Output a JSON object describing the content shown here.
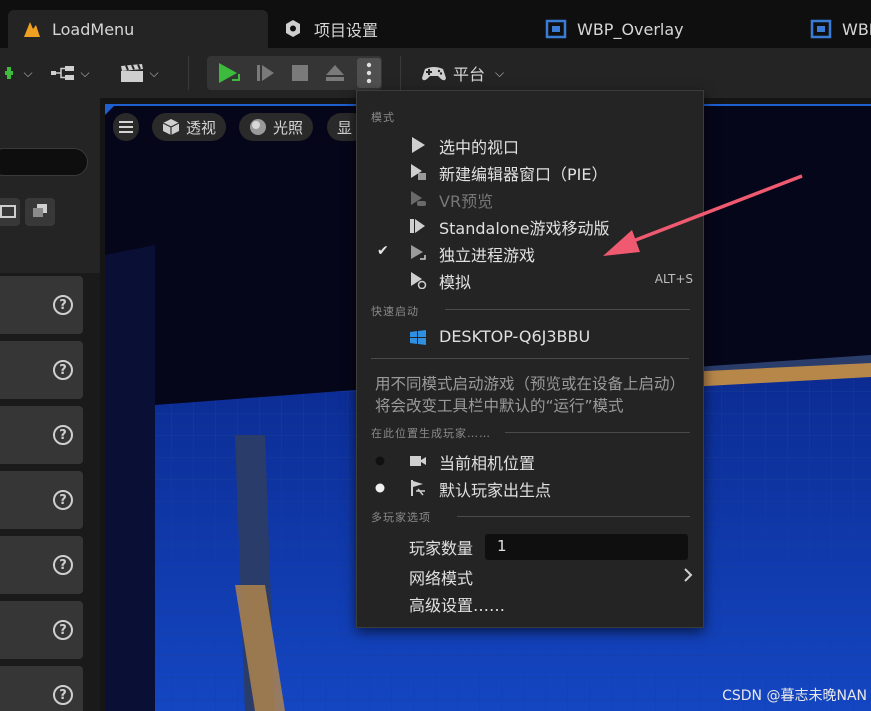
{
  "tabs": [
    {
      "label": "LoadMenu",
      "icon": "unreal-logo-icon",
      "active": true
    },
    {
      "label": "项目设置",
      "icon": "settings-icon",
      "active": false
    },
    {
      "label": "WBP_Overlay",
      "icon": "widget-blueprint-icon",
      "active": false
    },
    {
      "label": "WBI",
      "icon": "widget-blueprint-icon",
      "active": false
    }
  ],
  "toolbar": {
    "platform_label": "平台"
  },
  "viewport": {
    "perspective_label": "透视",
    "lighting_label": "光照",
    "show_label": "显"
  },
  "menu": {
    "section_modes": "模式",
    "items": [
      {
        "label": "选中的视口",
        "icon": "play-icon",
        "checked": false,
        "enabled": true,
        "shortcut": ""
      },
      {
        "label": "新建编辑器窗口（PIE）",
        "icon": "play-window-icon",
        "checked": false,
        "enabled": true,
        "shortcut": ""
      },
      {
        "label": "VR预览",
        "icon": "vr-icon",
        "checked": false,
        "enabled": false,
        "shortcut": ""
      },
      {
        "label": "Standalone游戏移动版",
        "icon": "mobile-play-icon",
        "checked": false,
        "enabled": true,
        "shortcut": ""
      },
      {
        "label": "独立进程游戏",
        "icon": "standalone-play-icon",
        "checked": true,
        "enabled": true,
        "shortcut": ""
      },
      {
        "label": "模拟",
        "icon": "simulate-icon",
        "checked": false,
        "enabled": true,
        "shortcut": "ALT+S"
      }
    ],
    "section_quick_launch": "快速启动",
    "device_label": "DESKTOP-Q6J3BBU",
    "description": "用不同模式启动游戏（预览或在设备上启动）将会改变工具栏中默认的“运行”模式",
    "section_spawn": "在此位置生成玩家……",
    "spawn_options": [
      {
        "label": "当前相机位置",
        "icon": "camera-icon",
        "selected": false
      },
      {
        "label": "默认玩家出生点",
        "icon": "player-start-icon",
        "selected": true
      }
    ],
    "section_multiplayer": "多玩家选项",
    "player_count_label": "玩家数量",
    "player_count_value": "1",
    "net_mode_label": "网络模式",
    "advanced_label": "高级设置……"
  },
  "watermark": "CSDN @暮志未晚NAN",
  "colors": {
    "accent_blue": "#1f5fd0",
    "play_green": "#3dbb3d",
    "annotation_arrow": "#f05a70",
    "ue_orange": "#f0a020"
  }
}
